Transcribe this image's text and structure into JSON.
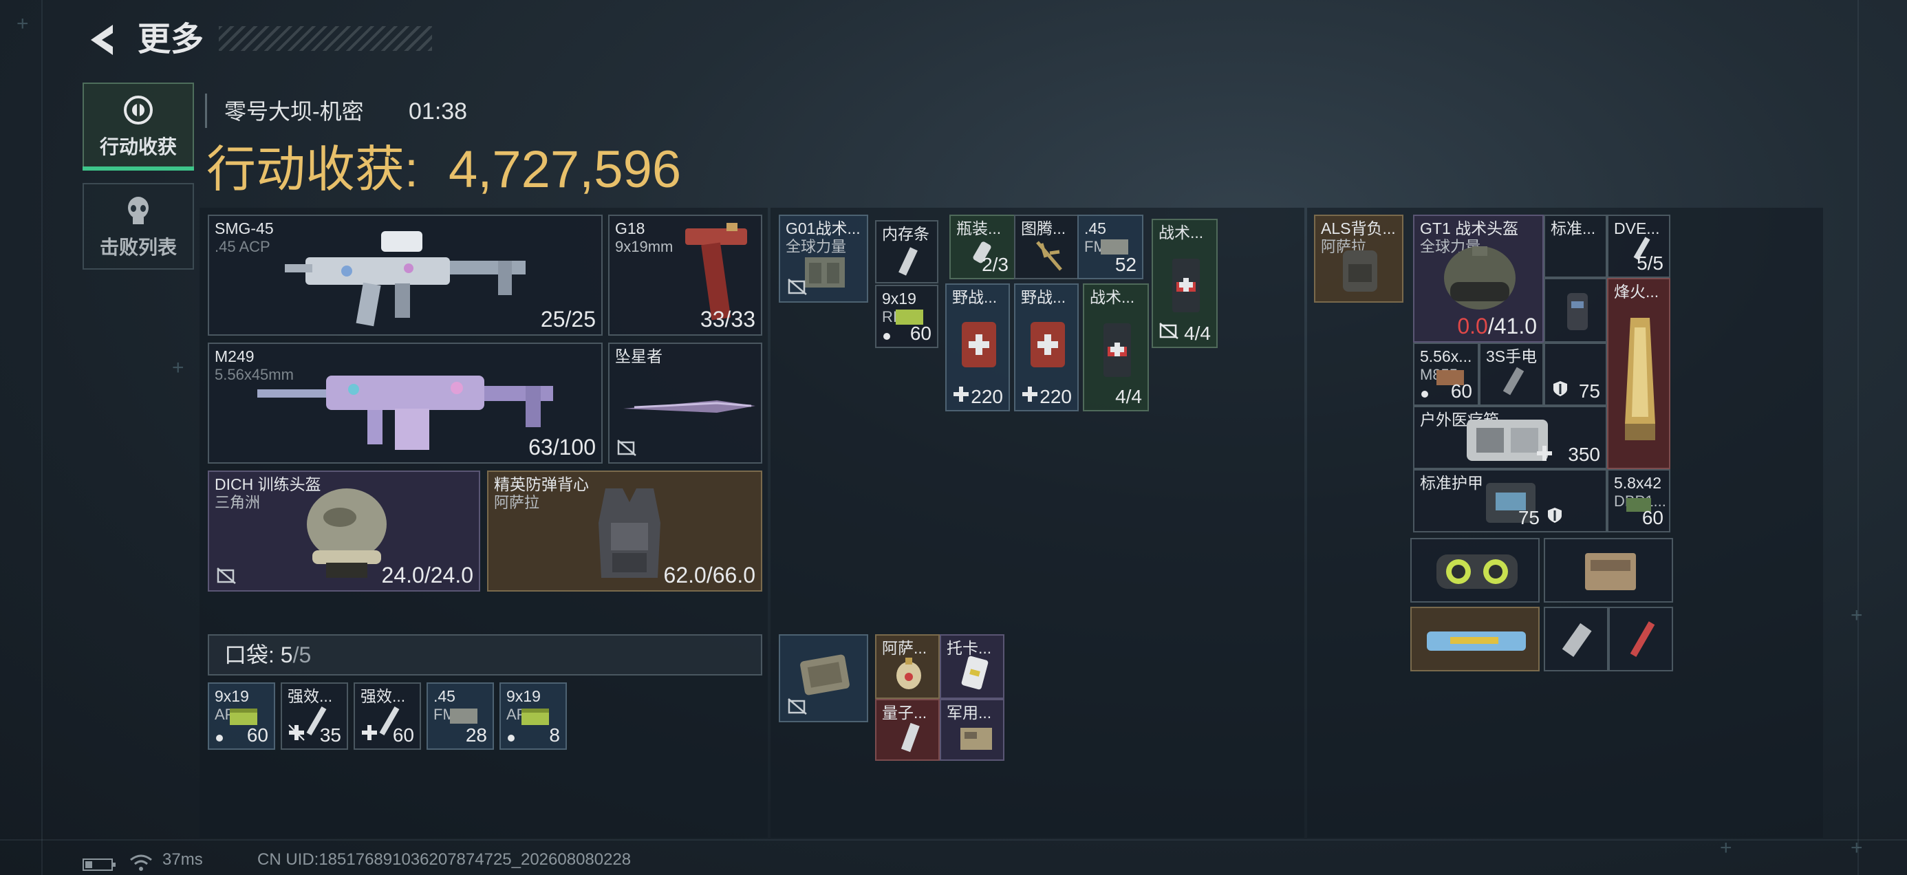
{
  "header": {
    "title": "更多",
    "back_icon": "back-arrow-icon"
  },
  "tabs": [
    {
      "label": "行动收获",
      "icon": "loot-target-icon",
      "active": true
    },
    {
      "label": "击败列表",
      "icon": "skull-icon",
      "active": false
    }
  ],
  "mission": {
    "map": "零号大坝-机密",
    "time": "01:38"
  },
  "loot": {
    "label": "行动收获:",
    "value": "4,727,596",
    "accent": "#e8c06a"
  },
  "equipment": {
    "smg": {
      "name": "SMG-45",
      "ammo": ".45 ACP",
      "count": "25/25"
    },
    "pistol": {
      "name": "G18",
      "ammo": "9x19mm",
      "count": "33/33"
    },
    "lmg": {
      "name": "M249",
      "ammo": "5.56x45mm",
      "count": "63/100"
    },
    "melee": {
      "name": "坠星者"
    },
    "helmet": {
      "name": "DICH 训练头盔",
      "brand": "三角洲",
      "durability": "24.0/24.0"
    },
    "vest": {
      "name": "精英防弹背心",
      "brand": "阿萨拉",
      "durability": "62.0/66.0"
    }
  },
  "pocket": {
    "label": "口袋:",
    "value": "5",
    "sep": "/",
    "max": "5",
    "items": [
      {
        "name": "9x19",
        "sub": "AP6.3",
        "count": "60"
      },
      {
        "name": "强效...",
        "count": "35"
      },
      {
        "name": "强效...",
        "count": "60"
      },
      {
        "name": ".45",
        "sub": "FMJ",
        "count": "28"
      },
      {
        "name": "9x19",
        "sub": "AP6.3",
        "count": "8"
      }
    ]
  },
  "chest": {
    "rig": {
      "name": "G01战术...",
      "brand": "全球力量"
    },
    "items": [
      {
        "name": "内存条"
      },
      {
        "name": "瓶装...",
        "count": "2/3"
      },
      {
        "name": "图腾..."
      },
      {
        "name": ".45",
        "sub": "FMJ",
        "count": "52"
      },
      {
        "name": "战术...",
        "count": "4/4"
      },
      {
        "name": "9x19",
        "sub": "RIP",
        "count": "60"
      },
      {
        "name": "野战...",
        "count": "220"
      },
      {
        "name": "野战...",
        "count": "220"
      },
      {
        "name": "战术...",
        "count": "4/4"
      }
    ],
    "case_items": [
      {
        "name": "阿萨..."
      },
      {
        "name": "托卡..."
      },
      {
        "name": "量子..."
      },
      {
        "name": "军用..."
      }
    ]
  },
  "backpack": {
    "bag": {
      "name": "ALS背负...",
      "brand": "阿萨拉"
    },
    "items": [
      {
        "name": "GT1 战术头盔",
        "brand": "全球力量",
        "durability_current": "0.0",
        "durability_max": "/41.0"
      },
      {
        "name": "标准..."
      },
      {
        "name": "DVE...",
        "count": "5/5"
      },
      {
        "name": "烽火..."
      },
      {
        "name": "5.56x...",
        "sub": "M855",
        "count": "60"
      },
      {
        "name": "3S手电"
      },
      {
        "name": "",
        "count": "75"
      },
      {
        "name": "户外医疗箱",
        "count": "350"
      },
      {
        "name": "标准护甲",
        "count": "75"
      },
      {
        "name": "5.8x42",
        "sub": "DBP1...",
        "count": "60"
      }
    ]
  },
  "footer": {
    "ping": "37ms",
    "uid": "CN UID:18517689103620787472​5_202608080228"
  }
}
